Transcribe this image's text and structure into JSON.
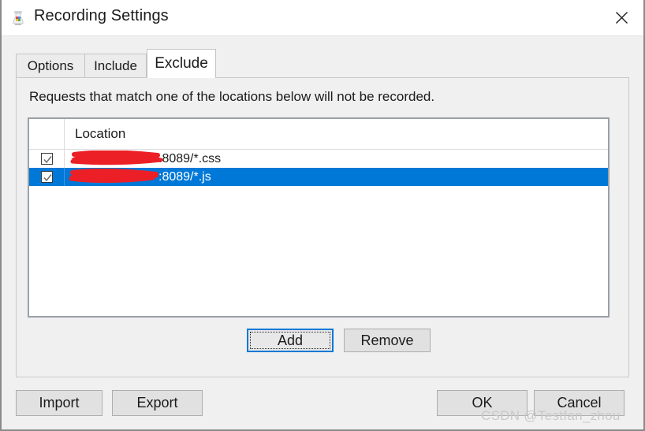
{
  "window": {
    "title": "Recording Settings",
    "icon": "jmeter-app-icon",
    "close_label": "✕"
  },
  "tabs": [
    {
      "id": "options",
      "label": "Options",
      "active": false
    },
    {
      "id": "include",
      "label": "Include",
      "active": false
    },
    {
      "id": "exclude",
      "label": "Exclude",
      "active": true
    }
  ],
  "panel": {
    "hint": "Requests that match one of the locations below will not be recorded."
  },
  "table": {
    "columns": [
      "",
      "Location"
    ],
    "rows": [
      {
        "checked": true,
        "selected": false,
        "location": ".8089/*.css",
        "redacted_prefix": true
      },
      {
        "checked": true,
        "selected": true,
        "location": ":8089/*.js",
        "redacted_prefix": true
      }
    ]
  },
  "list_buttons": {
    "add": "Add",
    "remove": "Remove"
  },
  "bottom_buttons": {
    "import": "Import",
    "export": "Export",
    "ok": "OK",
    "cancel": "Cancel"
  },
  "watermark": "CSDN @Testfan_zhou",
  "colors": {
    "selection_blue": "#0078d7",
    "redaction_red": "#ec1f26",
    "dialog_bg": "#f0f0f0",
    "button_face": "#e1e1e1",
    "focus_blue": "#0078d7",
    "text": "#1b1b1b",
    "watermark": "#c9c9c9"
  }
}
